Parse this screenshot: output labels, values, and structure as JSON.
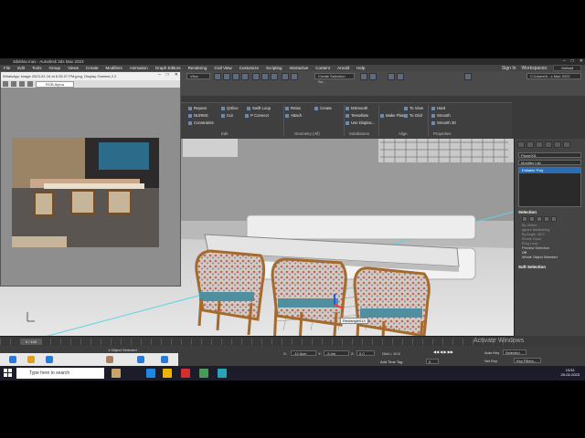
{
  "window": {
    "title": "3dsMax.max - Autodesk 3ds Max 2023",
    "controls": [
      "–",
      "□",
      "✕"
    ]
  },
  "menu": {
    "items": [
      "File",
      "Edit",
      "Tools",
      "Group",
      "Views",
      "Create",
      "Modifiers",
      "Animation",
      "Graph Editors",
      "Rendering",
      "Civil View",
      "Customize",
      "Scripting",
      "Interactive",
      "Content",
      "Arnold",
      "Help"
    ],
    "sign_in": "Sign In",
    "workspaces_label": "Workspaces:",
    "workspace": "Default"
  },
  "viewer": {
    "title": "WhatsApp Image 2023-02-16 at 6.35.07 PM.jpeg, Display Gamma 2.2",
    "channel": "RGB Alpha"
  },
  "toolbar": {
    "view_label": "View",
    "selection_set": "Create Selection Se...",
    "project_path": "C:\\Users\\K...x Max 2023"
  },
  "ribbon": {
    "column1": [
      "Repeat",
      "NURMS",
      "Constraints"
    ],
    "column2": [
      "QSlice",
      "Cut",
      "P Connect"
    ],
    "column3": [
      "Swift Loop"
    ],
    "column4": [
      "Relax",
      "Attach"
    ],
    "column5": [
      "Create"
    ],
    "column6": [
      "MSmooth",
      "Tessellate",
      "Use Displac..."
    ],
    "align_btn": "Make Planar",
    "column8": [
      "To View",
      "To Grid"
    ],
    "column9": [
      "Hard",
      "Smooth",
      "Smooth 30"
    ],
    "groups": [
      "Edit",
      "Geometry (All)",
      "Subdivision",
      "Align",
      "Properties"
    ]
  },
  "viewport": {
    "object_label": "Rectangle014"
  },
  "command_panel": {
    "object_name": "Plane001",
    "modifier_list": "Modifier List",
    "stack_item": "Editable Poly",
    "selection_title": "Selection",
    "selection_lines": [
      "By Vertex",
      "Ignore Backfacing",
      "By Angle: 45.0",
      "Shrink  Grow",
      "Ring  Loop"
    ],
    "preview_label": "Preview Selection",
    "preview_value": "Off",
    "whole_object": "Whole Object Selected",
    "soft_selection": "Soft Selection"
  },
  "timeline": {
    "frame": "0 / 100"
  },
  "status": {
    "objects_selected": "1 Object Selected",
    "x_label": "X:",
    "x_value": "-12.8cm",
    "y_label": "Y:",
    "y_value": "-5.4m",
    "z_label": "Z:",
    "z_value": "0.0",
    "grid": "Grid = 10.0",
    "add_time_tag": "Add Time Tag",
    "auto_key": "Auto Key",
    "set_key": "Set Key",
    "selected": "Selected",
    "key_filters": "Key Filters...",
    "frame_box": "0"
  },
  "watermark": {
    "line1": "Activate Windows",
    "line2": "Go to Settings to activate Windows."
  },
  "taskbar": {
    "search_placeholder": "Type here to search",
    "time": "13:51",
    "date": "20-02-2023"
  },
  "colors": {
    "accent": "#2a6db5",
    "viewport_bg": "#b9b9b9",
    "ui_dark": "#3a3a3a"
  }
}
